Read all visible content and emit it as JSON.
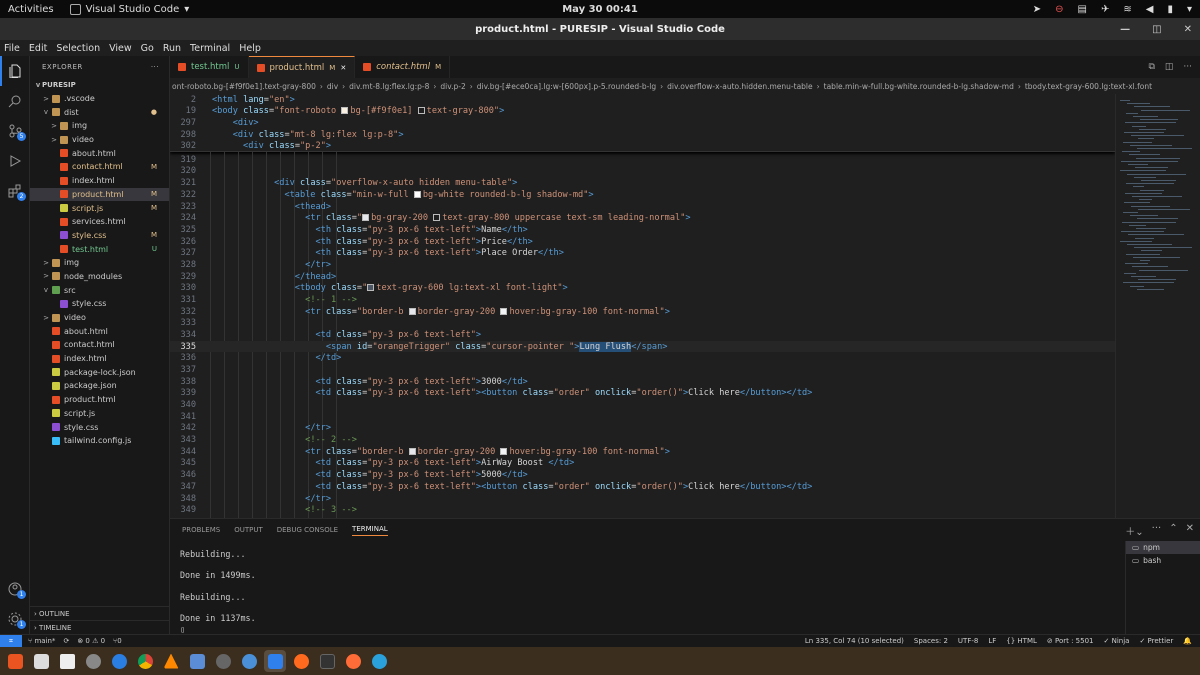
{
  "gnome": {
    "activities": "Activities",
    "app": "Visual Studio Code",
    "clock": "May 30  00:41"
  },
  "window": {
    "title": "product.html - PURESIP - Visual Studio Code"
  },
  "menu": [
    "File",
    "Edit",
    "Selection",
    "View",
    "Go",
    "Run",
    "Terminal",
    "Help"
  ],
  "explorer": {
    "header": "EXPLORER",
    "project": "PURESIP"
  },
  "tree": [
    {
      "label": ".vscode",
      "type": "folder",
      "depth": 1,
      "chev": ">",
      "status": ""
    },
    {
      "label": "dist",
      "type": "folder",
      "depth": 1,
      "chev": "v",
      "status": "●"
    },
    {
      "label": "img",
      "type": "folder",
      "depth": 2,
      "chev": ">",
      "status": ""
    },
    {
      "label": "video",
      "type": "folder",
      "depth": 2,
      "chev": ">",
      "status": ""
    },
    {
      "label": "about.html",
      "type": "html",
      "depth": 2,
      "chev": "",
      "status": ""
    },
    {
      "label": "contact.html",
      "type": "html",
      "depth": 2,
      "chev": "",
      "status": "M"
    },
    {
      "label": "index.html",
      "type": "html",
      "depth": 2,
      "chev": "",
      "status": ""
    },
    {
      "label": "product.html",
      "type": "html",
      "depth": 2,
      "chev": "",
      "status": "M",
      "selected": true
    },
    {
      "label": "script.js",
      "type": "js",
      "depth": 2,
      "chev": "",
      "status": "M"
    },
    {
      "label": "services.html",
      "type": "html",
      "depth": 2,
      "chev": "",
      "status": ""
    },
    {
      "label": "style.css",
      "type": "css",
      "depth": 2,
      "chev": "",
      "status": "M"
    },
    {
      "label": "test.html",
      "type": "html",
      "depth": 2,
      "chev": "",
      "status": "U"
    },
    {
      "label": "img",
      "type": "folder",
      "depth": 1,
      "chev": ">",
      "status": ""
    },
    {
      "label": "node_modules",
      "type": "folder",
      "depth": 1,
      "chev": ">",
      "status": ""
    },
    {
      "label": "src",
      "type": "src",
      "depth": 1,
      "chev": "v",
      "status": ""
    },
    {
      "label": "style.css",
      "type": "css",
      "depth": 2,
      "chev": "",
      "status": ""
    },
    {
      "label": "video",
      "type": "folder",
      "depth": 1,
      "chev": ">",
      "status": ""
    },
    {
      "label": "about.html",
      "type": "html",
      "depth": 1,
      "chev": "",
      "status": ""
    },
    {
      "label": "contact.html",
      "type": "html",
      "depth": 1,
      "chev": "",
      "status": ""
    },
    {
      "label": "index.html",
      "type": "html",
      "depth": 1,
      "chev": "",
      "status": ""
    },
    {
      "label": "package-lock.json",
      "type": "json",
      "depth": 1,
      "chev": "",
      "status": ""
    },
    {
      "label": "package.json",
      "type": "json",
      "depth": 1,
      "chev": "",
      "status": ""
    },
    {
      "label": "product.html",
      "type": "html",
      "depth": 1,
      "chev": "",
      "status": ""
    },
    {
      "label": "script.js",
      "type": "js",
      "depth": 1,
      "chev": "",
      "status": ""
    },
    {
      "label": "style.css",
      "type": "css",
      "depth": 1,
      "chev": "",
      "status": ""
    },
    {
      "label": "tailwind.config.js",
      "type": "tw",
      "depth": 1,
      "chev": "",
      "status": ""
    }
  ],
  "outline": "OUTLINE",
  "timeline": "TIMELINE",
  "tabs": [
    {
      "label": "test.html",
      "status": "U",
      "active": false,
      "italic": false
    },
    {
      "label": "product.html",
      "status": "M",
      "active": true,
      "italic": false
    },
    {
      "label": "contact.html",
      "status": "M",
      "active": false,
      "italic": true
    }
  ],
  "breadcrumb": [
    "ont-roboto.bg-[#f9f0e1].text-gray-800",
    "›",
    "div",
    "›",
    "div.mt-8.lg:flex.lg:p-8",
    "›",
    "div.p-2",
    "›",
    "div.bg-[#ece0ca].lg:w-[600px].p-5.rounded-b-lg",
    "›",
    "div.overflow-x-auto.hidden.menu-table",
    "›",
    "table.min-w-full.bg-white.rounded-b-lg.shadow-md",
    "›",
    "tbody.text-gray-600.lg:text-xl.font"
  ],
  "sticky": [
    {
      "n": "2",
      "html": "<span class='tg'>&lt;html</span> <span class='at'>lang</span>=<span class='st2'>\"en\"</span><span class='tg'>&gt;</span>"
    },
    {
      "n": "19",
      "html": "<span class='tg'>&lt;body</span> <span class='at'>class</span>=<span class='st2'>\"font-roboto <span class='sq' style='background:#f9f0e1'></span>bg-[#f9f0e1] <span class='sq'></span>text-gray-800\"</span><span class='tg'>&gt;</span>"
    },
    {
      "n": "297",
      "html": "    <span class='tg'>&lt;div&gt;</span>"
    },
    {
      "n": "298",
      "html": "    <span class='tg'>&lt;div</span> <span class='at'>class</span>=<span class='st2'>\"mt-8 lg:flex lg:p-8\"</span><span class='tg'>&gt;</span>"
    },
    {
      "n": "302",
      "html": "      <span class='tg'>&lt;div</span> <span class='at'>class</span>=<span class='st2'>\"p-2\"</span><span class='tg'>&gt;</span>"
    }
  ],
  "code": [
    {
      "n": "319",
      "html": ""
    },
    {
      "n": "320",
      "html": ""
    },
    {
      "n": "321",
      "html": "            <span class='tg'>&lt;div</span> <span class='at'>class</span>=<span class='st2'>\"overflow-x-auto hidden menu-table\"</span><span class='tg'>&gt;</span>"
    },
    {
      "n": "322",
      "html": "              <span class='tg'>&lt;table</span> <span class='at'>class</span>=<span class='st2'>\"min-w-full <span class='sq' style='background:#fff'></span>bg-white rounded-b-lg shadow-md\"</span><span class='tg'>&gt;</span>"
    },
    {
      "n": "323",
      "html": "                <span class='tg'>&lt;thead&gt;</span>"
    },
    {
      "n": "324",
      "html": "                  <span class='tg'>&lt;tr</span> <span class='at'>class</span>=<span class='st2'>\"<span class='sq' style='background:#e5e7eb'></span>bg-gray-200 <span class='sq'></span>text-gray-800 uppercase text-sm leading-normal\"</span><span class='tg'>&gt;</span>"
    },
    {
      "n": "325",
      "html": "                    <span class='tg'>&lt;th</span> <span class='at'>class</span>=<span class='st2'>\"py-3 px-6 text-left\"</span><span class='tg'>&gt;</span>Name<span class='tg'>&lt;/th&gt;</span>"
    },
    {
      "n": "326",
      "html": "                    <span class='tg'>&lt;th</span> <span class='at'>class</span>=<span class='st2'>\"py-3 px-6 text-left\"</span><span class='tg'>&gt;</span>Price<span class='tg'>&lt;/th&gt;</span>"
    },
    {
      "n": "327",
      "html": "                    <span class='tg'>&lt;th</span> <span class='at'>class</span>=<span class='st2'>\"py-3 px-6 text-left\"</span><span class='tg'>&gt;</span>Place Order<span class='tg'>&lt;/th&gt;</span>"
    },
    {
      "n": "328",
      "html": "                  <span class='tg'>&lt;/tr&gt;</span>"
    },
    {
      "n": "329",
      "html": "                <span class='tg'>&lt;/thead&gt;</span>"
    },
    {
      "n": "330",
      "html": "                <span class='tg'>&lt;tbody</span> <span class='at'>class</span>=<span class='st2'>\"<span class='sq' style='background:#4b5563'></span>text-gray-600 lg:text-xl font-light\"</span><span class='tg'>&gt;</span>"
    },
    {
      "n": "331",
      "html": "                  <span class='cm'>&lt;!-- 1 --&gt;</span>"
    },
    {
      "n": "332",
      "html": "                  <span class='tg'>&lt;tr</span> <span class='at'>class</span>=<span class='st2'>\"border-b <span class='sq' style='background:#e5e7eb'></span>border-gray-200 <span class='sq' style='background:#f3f4f6'></span>hover:bg-gray-100 font-normal\"</span><span class='tg'>&gt;</span>"
    },
    {
      "n": "333",
      "html": ""
    },
    {
      "n": "334",
      "html": "                    <span class='tg'>&lt;td</span> <span class='at'>class</span>=<span class='st2'>\"py-3 px-6 text-left\"</span><span class='tg'>&gt;</span>"
    },
    {
      "n": "335",
      "html": "                      <span class='tg'>&lt;span</span> <span class='at'>id</span>=<span class='st2'>\"orangeTrigger\"</span> <span class='at'>class</span>=<span class='st2'>\"cursor-pointer \"</span><span class='tg'>&gt;</span><span class='hl'>Lung Flush</span><span class='tg'>&lt;/span&gt;</span>",
      "cur": true
    },
    {
      "n": "336",
      "html": "                    <span class='tg'>&lt;/td&gt;</span>"
    },
    {
      "n": "337",
      "html": ""
    },
    {
      "n": "338",
      "html": "                    <span class='tg'>&lt;td</span> <span class='at'>class</span>=<span class='st2'>\"py-3 px-6 text-left\"</span><span class='tg'>&gt;</span>3000<span class='tg'>&lt;/td&gt;</span>"
    },
    {
      "n": "339",
      "html": "                    <span class='tg'>&lt;td</span> <span class='at'>class</span>=<span class='st2'>\"py-3 px-6 text-left\"</span><span class='tg'>&gt;&lt;button</span> <span class='at'>class</span>=<span class='st2'>\"order\"</span> <span class='at'>onclick</span>=<span class='st2'>\"order()\"</span><span class='tg'>&gt;</span>Click here<span class='tg'>&lt;/button&gt;&lt;/td&gt;</span>"
    },
    {
      "n": "340",
      "html": ""
    },
    {
      "n": "341",
      "html": ""
    },
    {
      "n": "342",
      "html": "                  <span class='tg'>&lt;/tr&gt;</span>"
    },
    {
      "n": "343",
      "html": "                  <span class='cm'>&lt;!-- 2 --&gt;</span>"
    },
    {
      "n": "344",
      "html": "                  <span class='tg'>&lt;tr</span> <span class='at'>class</span>=<span class='st2'>\"border-b <span class='sq' style='background:#e5e7eb'></span>border-gray-200 <span class='sq' style='background:#f3f4f6'></span>hover:bg-gray-100 font-normal\"</span><span class='tg'>&gt;</span>"
    },
    {
      "n": "345",
      "html": "                    <span class='tg'>&lt;td</span> <span class='at'>class</span>=<span class='st2'>\"py-3 px-6 text-left\"</span><span class='tg'>&gt;</span>AirWay Boost <span class='tg'>&lt;/td&gt;</span>"
    },
    {
      "n": "346",
      "html": "                    <span class='tg'>&lt;td</span> <span class='at'>class</span>=<span class='st2'>\"py-3 px-6 text-left\"</span><span class='tg'>&gt;</span>5000<span class='tg'>&lt;/td&gt;</span>"
    },
    {
      "n": "347",
      "html": "                    <span class='tg'>&lt;td</span> <span class='at'>class</span>=<span class='st2'>\"py-3 px-6 text-left\"</span><span class='tg'>&gt;&lt;button</span> <span class='at'>class</span>=<span class='st2'>\"order\"</span> <span class='at'>onclick</span>=<span class='st2'>\"order()\"</span><span class='tg'>&gt;</span>Click here<span class='tg'>&lt;/button&gt;&lt;/td&gt;</span>"
    },
    {
      "n": "348",
      "html": "                  <span class='tg'>&lt;/tr&gt;</span>"
    },
    {
      "n": "349",
      "html": "                  <span class='cm'>&lt;!-- 3 --&gt;</span>"
    }
  ],
  "panel": {
    "tabs": [
      "PROBLEMS",
      "OUTPUT",
      "DEBUG CONSOLE",
      "TERMINAL"
    ],
    "active": "TERMINAL",
    "lines": [
      "Rebuilding...",
      "",
      "Done in 1499ms.",
      "",
      "Rebuilding...",
      "",
      "Done in 1137ms.",
      "▯"
    ],
    "terminals": [
      "npm",
      "bash"
    ]
  },
  "status": {
    "branch": "main*",
    "sync": "⟳",
    "errors": "⊗ 0 ⚠ 0",
    "ports": "⑂0",
    "position": "Ln 335, Col 74 (10 selected)",
    "spaces": "Spaces: 2",
    "encoding": "UTF-8",
    "eol": "LF",
    "lang": "HTML",
    "port": "Port : 5501",
    "ninja": "Ninja",
    "prettier": "✓ Prettier"
  }
}
